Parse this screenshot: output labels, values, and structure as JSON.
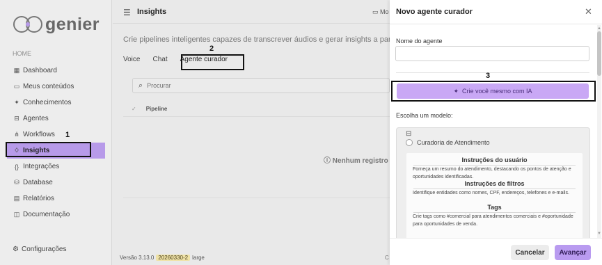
{
  "brand": {
    "logo_text": "genier",
    "accent": "#b79ae9"
  },
  "sidebar": {
    "section": "HOME",
    "items": [
      {
        "label": "Dashboard",
        "icon": "grid-icon"
      },
      {
        "label": "Meus conteúdos",
        "icon": "folder-icon"
      },
      {
        "label": "Conhecimentos",
        "icon": "sparkle-icon"
      },
      {
        "label": "Agentes",
        "icon": "robot-icon"
      },
      {
        "label": "Workflows",
        "icon": "workflow-icon"
      },
      {
        "label": "Insights",
        "icon": "lightbulb-icon",
        "active": true
      },
      {
        "label": "Integrações",
        "icon": "code-braces-icon"
      },
      {
        "label": "Database",
        "icon": "database-icon"
      },
      {
        "label": "Relatórios",
        "icon": "report-icon"
      },
      {
        "label": "Documentação",
        "icon": "book-icon"
      }
    ],
    "settings": "Configurações"
  },
  "annotations": {
    "a1": "1",
    "a2": "2",
    "a3": "3"
  },
  "header": {
    "title": "Insights",
    "monitor_label": "Mo"
  },
  "main": {
    "description": "Crie pipelines inteligentes capazes de transcrever áudios e gerar insights a partir",
    "tabs": [
      "Voice",
      "Chat",
      "Agente curador"
    ],
    "search_placeholder": "Procurar",
    "table_column": "Pipeline",
    "empty_text": "Nenhum registro"
  },
  "footer": {
    "version": "Versão 3.13.0",
    "build": "20260330-2",
    "size": "large",
    "extra": "C"
  },
  "drawer": {
    "title": "Novo agente curador",
    "name_label": "Nome do agente",
    "name_value": "",
    "ai_button": "Crie você mesmo com IA",
    "model_label": "Escolha um modelo:",
    "model": {
      "name": "Curadoria de Atendimento",
      "sections": [
        {
          "title": "Instruções do usuário",
          "text": "Forneça um resumo do atendimento, destacando os pontos de atenção e oportunidades identificadas."
        },
        {
          "title": "Instruções de filtros",
          "text": "Identifique entidades como nomes, CPF, endereços, telefones e e-mails."
        },
        {
          "title": "Tags",
          "text": "Crie tags como #comercial para atendimentos comerciais e #oportunidade para oportunidades de venda."
        }
      ]
    },
    "cancel": "Cancelar",
    "next": "Avançar"
  }
}
